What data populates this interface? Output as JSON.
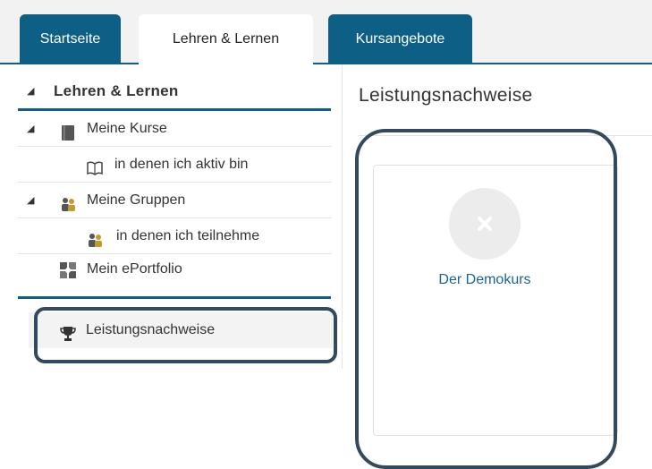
{
  "tabs": [
    {
      "label": "Startseite",
      "active": false
    },
    {
      "label": "Lehren & Lernen",
      "active": true
    },
    {
      "label": "Kursangebote",
      "active": false
    }
  ],
  "sidebar": {
    "header": "Lehren & Lernen",
    "items": [
      {
        "label": "Meine Kurse",
        "icon": "book-icon"
      },
      {
        "label": "in denen ich aktiv bin",
        "icon": "open-book-icon"
      },
      {
        "label": "Meine Gruppen",
        "icon": "group-icon"
      },
      {
        "label": "in denen ich teilnehme",
        "icon": "group-member-icon"
      },
      {
        "label": "Mein ePortfolio",
        "icon": "portfolio-icon"
      },
      {
        "label": "Leistungsnachweise",
        "icon": "trophy-icon"
      }
    ]
  },
  "main": {
    "title": "Leistungsnachweise",
    "card": {
      "label": "Der Demokurs",
      "icon": "close-icon"
    }
  },
  "colors": {
    "brand": "#0d5f86",
    "link": "#1a6496",
    "callout": "#34495e"
  }
}
